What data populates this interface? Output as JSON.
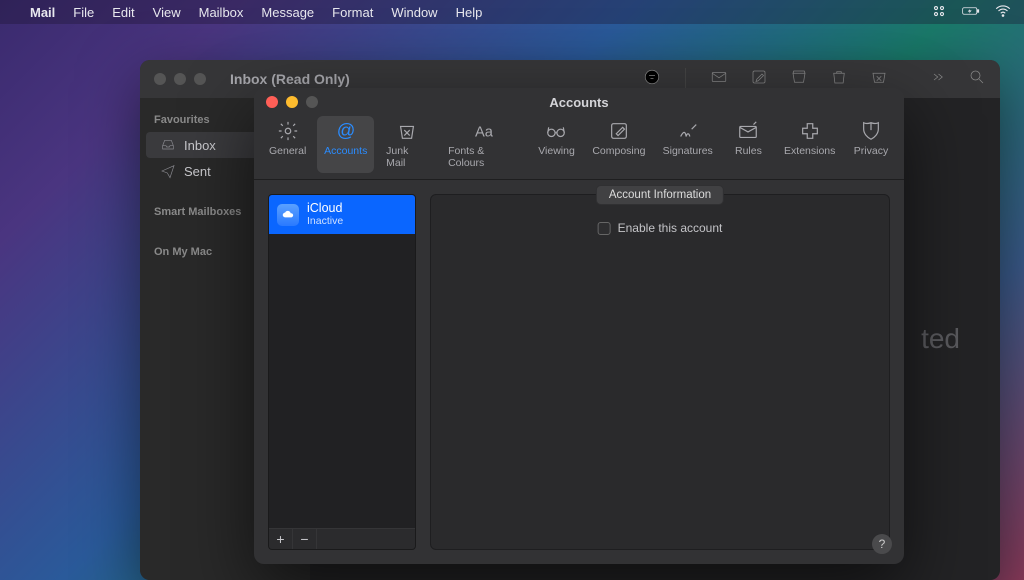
{
  "menubar": {
    "app": "Mail",
    "items": [
      "File",
      "Edit",
      "View",
      "Mailbox",
      "Message",
      "Format",
      "Window",
      "Help"
    ]
  },
  "mailWindow": {
    "title": "Inbox (Read Only)",
    "sidebar": {
      "sections": [
        {
          "heading": "Favourites",
          "items": [
            {
              "label": "Inbox",
              "icon": "inbox-icon",
              "active": true
            },
            {
              "label": "Sent",
              "icon": "sent-icon",
              "active": false
            }
          ]
        },
        {
          "heading": "Smart Mailboxes",
          "items": []
        },
        {
          "heading": "On My Mac",
          "items": []
        }
      ]
    },
    "backgroundHint": "ted"
  },
  "prefWindow": {
    "title": "Accounts",
    "tabs": [
      {
        "label": "General",
        "icon": "gear-icon"
      },
      {
        "label": "Accounts",
        "icon": "at-icon",
        "active": true
      },
      {
        "label": "Junk Mail",
        "icon": "junk-icon"
      },
      {
        "label": "Fonts & Colours",
        "icon": "fonts-icon"
      },
      {
        "label": "Viewing",
        "icon": "glasses-icon"
      },
      {
        "label": "Composing",
        "icon": "compose-icon"
      },
      {
        "label": "Signatures",
        "icon": "signature-icon"
      },
      {
        "label": "Rules",
        "icon": "rules-icon"
      },
      {
        "label": "Extensions",
        "icon": "extensions-icon"
      },
      {
        "label": "Privacy",
        "icon": "privacy-icon"
      }
    ],
    "accounts": [
      {
        "name": "iCloud",
        "status": "Inactive",
        "selected": true
      }
    ],
    "addLabel": "+",
    "removeLabel": "−",
    "detailTab": "Account Information",
    "enableLabel": "Enable this account",
    "helpLabel": "?"
  }
}
